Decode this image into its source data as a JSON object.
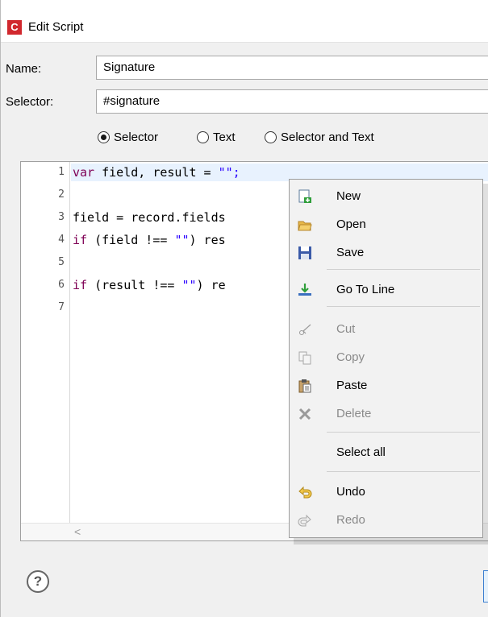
{
  "window": {
    "title": "Edit Script",
    "logo_letter": "C"
  },
  "form": {
    "name_label": "Name:",
    "name_value": "Signature",
    "selector_label": "Selector:",
    "selector_value": "#signature",
    "radios": [
      {
        "label": "Selector",
        "checked": true
      },
      {
        "label": "Text",
        "checked": false
      },
      {
        "label": "Selector and Text",
        "checked": false
      }
    ]
  },
  "editor": {
    "line_numbers": [
      "1",
      "2",
      "3",
      "4",
      "5",
      "6",
      "7"
    ],
    "lines": {
      "l1_kw": "var",
      "l1_rest": " field, result = ",
      "l1_str": "\"\";",
      "l3": "field = record.fields",
      "l4_kw": "if",
      "l4_pre": " (field !== ",
      "l4_str": "\"\"",
      "l4_post": ") res",
      "l6_kw": "if",
      "l6_pre": " (result !== ",
      "l6_str": "\"\"",
      "l6_post": ") re"
    },
    "scroll_left_glyph": "<"
  },
  "context_menu": {
    "items": [
      {
        "label": "New",
        "icon": "new-file-icon",
        "enabled": true
      },
      {
        "label": "Open",
        "icon": "open-folder-icon",
        "enabled": true
      },
      {
        "label": "Save",
        "icon": "floppy-disk-icon",
        "enabled": true
      },
      {
        "label": "Go To Line",
        "icon": "go-to-line-icon",
        "enabled": true
      },
      {
        "label": "Cut",
        "icon": "scissors-icon",
        "enabled": false
      },
      {
        "label": "Copy",
        "icon": "copy-icon",
        "enabled": false
      },
      {
        "label": "Paste",
        "icon": "clipboard-icon",
        "enabled": true
      },
      {
        "label": "Delete",
        "icon": "delete-x-icon",
        "enabled": false
      },
      {
        "label": "Select all",
        "icon": "",
        "enabled": true
      },
      {
        "label": "Undo",
        "icon": "undo-arrow-icon",
        "enabled": true
      },
      {
        "label": "Redo",
        "icon": "redo-arrow-icon",
        "enabled": false
      }
    ]
  },
  "footer": {
    "help_glyph": "?"
  },
  "colors": {
    "keyword": "#7f0055",
    "string": "#2a00ff",
    "logo": "#d1282e",
    "current_line": "#e8f2fe"
  }
}
